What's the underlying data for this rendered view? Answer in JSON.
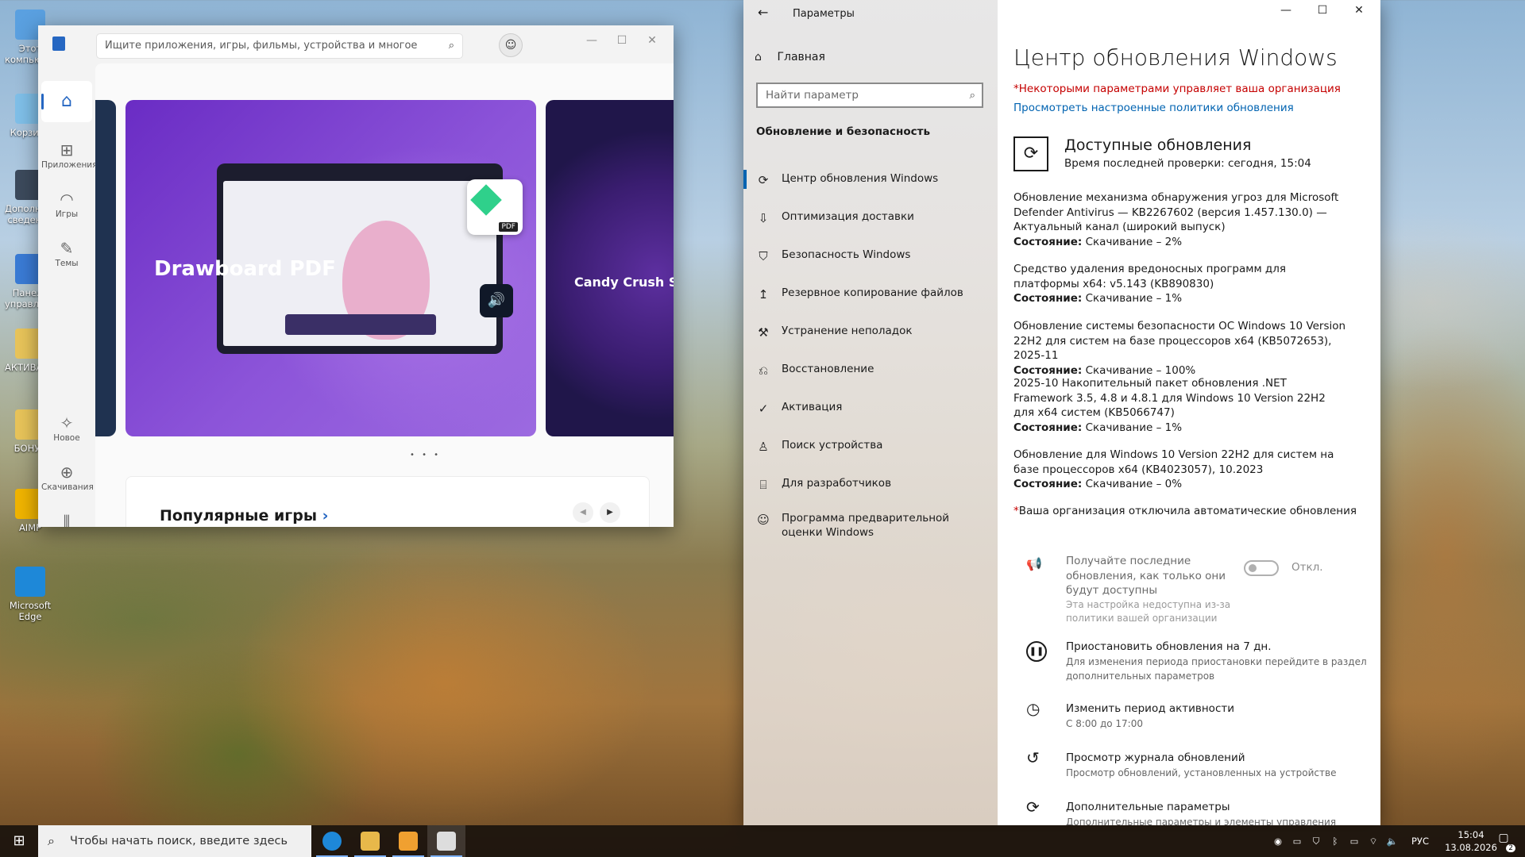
{
  "desktop": {
    "icons": [
      {
        "label": "Этот компьютер",
        "color": "#5aa0e0"
      },
      {
        "label": "Корзина",
        "color": "#7fbfe8"
      },
      {
        "label": "Дополнительные сведения",
        "color": "#3c4a5c"
      },
      {
        "label": "Панель управления",
        "color": "#3a7bd5"
      },
      {
        "label": "АКТИВАЦИЯ",
        "color": "#e8c45a"
      },
      {
        "label": "БОНУС",
        "color": "#e8c45a"
      },
      {
        "label": "AIMP",
        "color": "#f0b400"
      },
      {
        "label": "Microsoft Edge",
        "color": "#1e88d8"
      }
    ]
  },
  "store": {
    "search_placeholder": "Ищите приложения, игры, фильмы, устройства и многое другое",
    "nav": [
      {
        "label": "Главная",
        "icon": "home-icon",
        "glyph": "⌂"
      },
      {
        "label": "Приложения",
        "icon": "apps-icon",
        "glyph": "⊞"
      },
      {
        "label": "Игры",
        "icon": "gamepad-icon",
        "glyph": "◠"
      },
      {
        "label": "Темы",
        "icon": "brush-icon",
        "glyph": "✎"
      },
      {
        "label": "Новое",
        "icon": "whatsnew-icon",
        "glyph": "✧"
      },
      {
        "label": "Скачивания",
        "icon": "downloads-icon",
        "glyph": "⊕"
      },
      {
        "label": "Библиотека",
        "icon": "library-icon",
        "glyph": "⫴"
      }
    ],
    "hero_title": "Drawboard PDF",
    "hero_badge": "PDF",
    "hero2_title": "Candy Crush Saga",
    "popular_title": "Популярные игры",
    "popular_arrow": "›"
  },
  "settings": {
    "window_title": "Параметры",
    "home_label": "Главная",
    "search_placeholder": "Найти параметр",
    "category": "Обновление и безопасность",
    "nav": [
      {
        "label": "Центр обновления Windows",
        "icon": "refresh-icon",
        "glyph": "⟳"
      },
      {
        "label": "Оптимизация доставки",
        "icon": "delivery-icon",
        "glyph": "⇩"
      },
      {
        "label": "Безопасность Windows",
        "icon": "shield-icon",
        "glyph": "⛉"
      },
      {
        "label": "Резервное копирование файлов",
        "icon": "backup-icon",
        "glyph": "↥"
      },
      {
        "label": "Устранение неполадок",
        "icon": "wrench-icon",
        "glyph": "⚒"
      },
      {
        "label": "Восстановление",
        "icon": "recovery-icon",
        "glyph": "⎌"
      },
      {
        "label": "Активация",
        "icon": "check-circle-icon",
        "glyph": "✓"
      },
      {
        "label": "Поиск устройства",
        "icon": "find-device-icon",
        "glyph": "♙"
      },
      {
        "label": "Для разработчиков",
        "icon": "developer-icon",
        "glyph": "⌸"
      },
      {
        "label": "Программа предварительной оценки Windows",
        "icon": "insider-icon",
        "glyph": "☺"
      }
    ],
    "page_title": "Центр обновления Windows",
    "org_warning": "*Некоторыми параметрами управляет ваша организация",
    "policy_link": "Просмотреть настроенные политики обновления",
    "available_title": "Доступные обновления",
    "last_check": "Время последней проверки: сегодня, 15:04",
    "status_label": "Состояние:",
    "updates": [
      {
        "name": "Обновление механизма обнаружения угроз для Microsoft Defender Antivirus — KB2267602 (версия 1.457.130.0) — Актуальный канал (широкий выпуск)",
        "status": "Скачивание – 2%"
      },
      {
        "name": "Средство удаления вредоносных программ для платформы x64: v5.143 (KB890830)",
        "status": "Скачивание – 1%"
      },
      {
        "name": "Обновление системы безопасности ОС Windows 10 Version 22H2 для систем на базе процессоров x64 (KB5072653), 2025-11",
        "status": "Скачивание – 100%"
      },
      {
        "name": "2025-10 Накопительный пакет обновления .NET Framework 3.5, 4.8 и 4.8.1 для Windows 10 Version 22H2 для x64 систем (KB5066747)",
        "status": "Скачивание – 1%"
      },
      {
        "name": "Обновление для Windows 10 Version 22H2 для систем на базе процессоров x64 (KB4023057), 10.2023",
        "status": "Скачивание – 0%"
      }
    ],
    "auto_note": "Ваша организация отключила автоматические обновления",
    "auto_note_star": "*",
    "toggle": {
      "label": "Получайте последние обновления, как только они будут доступны",
      "sub": "Эта настройка недоступна из-за политики вашей организации",
      "state": "Откл."
    },
    "options": [
      {
        "title": "Приостановить обновления на 7 дн.",
        "sub": "Для изменения периода приостановки перейдите в раздел дополнительных параметров",
        "icon": "pause-icon",
        "glyph": "❚❚"
      },
      {
        "title": "Изменить период активности",
        "sub": "С 8:00 до 17:00",
        "icon": "active-hours-icon",
        "glyph": "◷"
      },
      {
        "title": "Просмотр журнала обновлений",
        "sub": "Просмотр обновлений, установленных на устройстве",
        "icon": "history-icon",
        "glyph": "↺"
      },
      {
        "title": "Дополнительные параметры",
        "sub": "Дополнительные параметры и элементы управления",
        "icon": "advanced-icon",
        "glyph": "⟳"
      }
    ]
  },
  "taskbar": {
    "search_placeholder": "Чтобы начать поиск, введите здесь запрос",
    "apps": [
      {
        "name": "edge",
        "icon": "edge-icon",
        "color": "#1e88d8"
      },
      {
        "name": "explorer",
        "icon": "folder-icon",
        "color": "#e8b84a"
      },
      {
        "name": "store",
        "icon": "store-icon",
        "color": "#f0a030"
      },
      {
        "name": "settings",
        "icon": "gear-icon",
        "color": "#dddddd"
      }
    ],
    "language": "РУС",
    "time": "15:04",
    "date": "13.08.2026",
    "notification_count": "2"
  }
}
